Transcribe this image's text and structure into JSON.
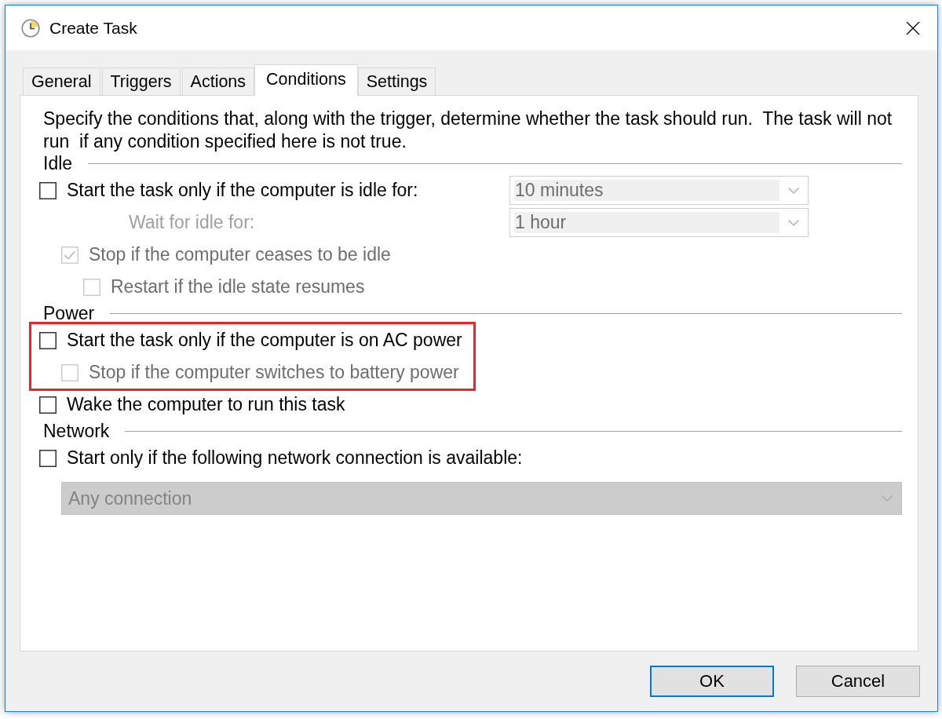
{
  "window": {
    "title": "Create Task"
  },
  "tabs": [
    {
      "label": "General",
      "selected": false
    },
    {
      "label": "Triggers",
      "selected": false
    },
    {
      "label": "Actions",
      "selected": false
    },
    {
      "label": "Conditions",
      "selected": true
    },
    {
      "label": "Settings",
      "selected": false
    }
  ],
  "description": "Specify the conditions that, along with the trigger, determine whether the task should run.  The task will not run  if any condition specified here is not true.",
  "sections": [
    {
      "title": "Idle",
      "items": [
        {
          "kind": "checkbox",
          "label": "Start the task only if the computer is idle for:",
          "checked": false,
          "disabled": false,
          "highlighted": false,
          "dropdown": {
            "kind": "combo",
            "value": "10 minutes",
            "disabled": true
          },
          "children": [
            {
              "kind": "field",
              "label": "Wait for idle for:",
              "disabled": true,
              "dropdown": {
                "kind": "combo",
                "value": "1 hour",
                "disabled": true
              }
            },
            {
              "kind": "checkbox",
              "label": "Stop if the computer ceases to be idle",
              "checked": true,
              "disabled": true,
              "children": [
                {
                  "kind": "checkbox",
                  "label": "Restart if the idle state resumes",
                  "checked": false,
                  "disabled": true
                }
              ]
            }
          ]
        }
      ]
    },
    {
      "title": "Power",
      "items": [
        {
          "kind": "checkbox",
          "label": "Start the task only if the computer is on AC power",
          "checked": false,
          "disabled": false,
          "highlighted": true,
          "children": [
            {
              "kind": "checkbox",
              "label": "Stop if the computer switches to battery power",
              "checked": false,
              "disabled": true
            }
          ]
        },
        {
          "kind": "checkbox",
          "label": "Wake the computer to run this task",
          "checked": false,
          "disabled": false,
          "highlighted": false
        }
      ]
    },
    {
      "title": "Network",
      "items": [
        {
          "kind": "checkbox",
          "label": "Start only if the following network connection is available:",
          "checked": false,
          "disabled": false,
          "highlighted": false,
          "children": [
            {
              "kind": "dropdown",
              "dropdown": {
                "kind": "list",
                "value": "Any connection",
                "disabled": true
              }
            }
          ]
        }
      ]
    }
  ],
  "buttons": [
    {
      "label": "OK",
      "default": true
    },
    {
      "label": "Cancel",
      "default": false
    }
  ]
}
